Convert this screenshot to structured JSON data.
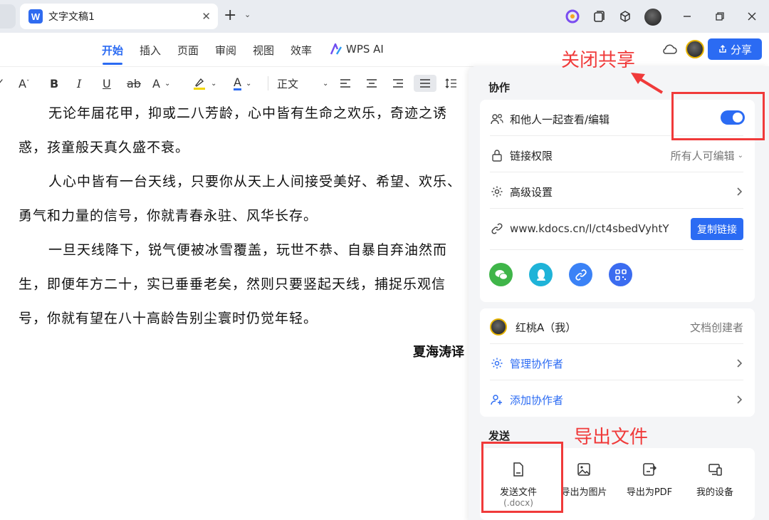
{
  "titlebar": {
    "doc_title": "文字文稿1",
    "tab_logo": "W",
    "close_glyph": "✕",
    "new_tab_glyph": "+",
    "new_tab_arrow": "⌄"
  },
  "menu": {
    "items": [
      "开始",
      "插入",
      "页面",
      "审阅",
      "视图",
      "效率",
      "WPS AI"
    ],
    "share_label": "分享"
  },
  "toolbar": {
    "style_label": "正文",
    "buttons": [
      "B",
      "I",
      "U",
      "ab",
      "A",
      "A"
    ]
  },
  "document": {
    "lines": [
      "无论年届花甲，抑或二八芳龄，心中皆有生命之欢乐，奇迹之诱",
      "惑，孩童般天真久盛不衰。",
      "人心中皆有一台天线，只要你从天上人间接受美好、希望、欢乐、",
      "勇气和力量的信号，你就青春永驻、风华长存。",
      "一旦天线降下，锐气便被冰雪覆盖，玩世不恭、自暴自弃油然而",
      "生，即便年方二十，实已垂垂老矣，然则只要竖起天线，捕捉乐观信",
      "号，你就有望在八十高龄告别尘寰时仍觉年轻。"
    ],
    "signature": "夏海涛译"
  },
  "panel": {
    "collab_title": "协作",
    "collab_row": "和他人一起查看/编辑",
    "toggle_on": true,
    "permission_label": "链接权限",
    "permission_value": "所有人可编辑",
    "advanced_label": "高级设置",
    "link_url": "www.kdocs.cn/l/ct4sbedVyhtY",
    "copy_link": "复制链接",
    "share_targets": [
      "wechat-icon",
      "qq-icon",
      "link-icon",
      "qrcode-icon"
    ],
    "user_name": "红桃A（我）",
    "user_role": "文档创建者",
    "manage_label": "管理协作者",
    "add_label": "添加协作者",
    "send_title": "发送",
    "send_items": [
      {
        "label": "发送文件",
        "sub": "(.docx)"
      },
      {
        "label": "导出为图片",
        "sub": ""
      },
      {
        "label": "导出为PDF",
        "sub": ""
      },
      {
        "label": "我的设备",
        "sub": ""
      }
    ]
  },
  "annotations": {
    "close_share": "关闭共享",
    "export_file": "导出文件",
    "color": "#f03a3a"
  },
  "colors": {
    "accent": "#2b6bf3",
    "wechat": "#3fb549",
    "qq": "#1fb3d8",
    "link": "#3b82f6",
    "qrcode": "#3b6cf0"
  }
}
